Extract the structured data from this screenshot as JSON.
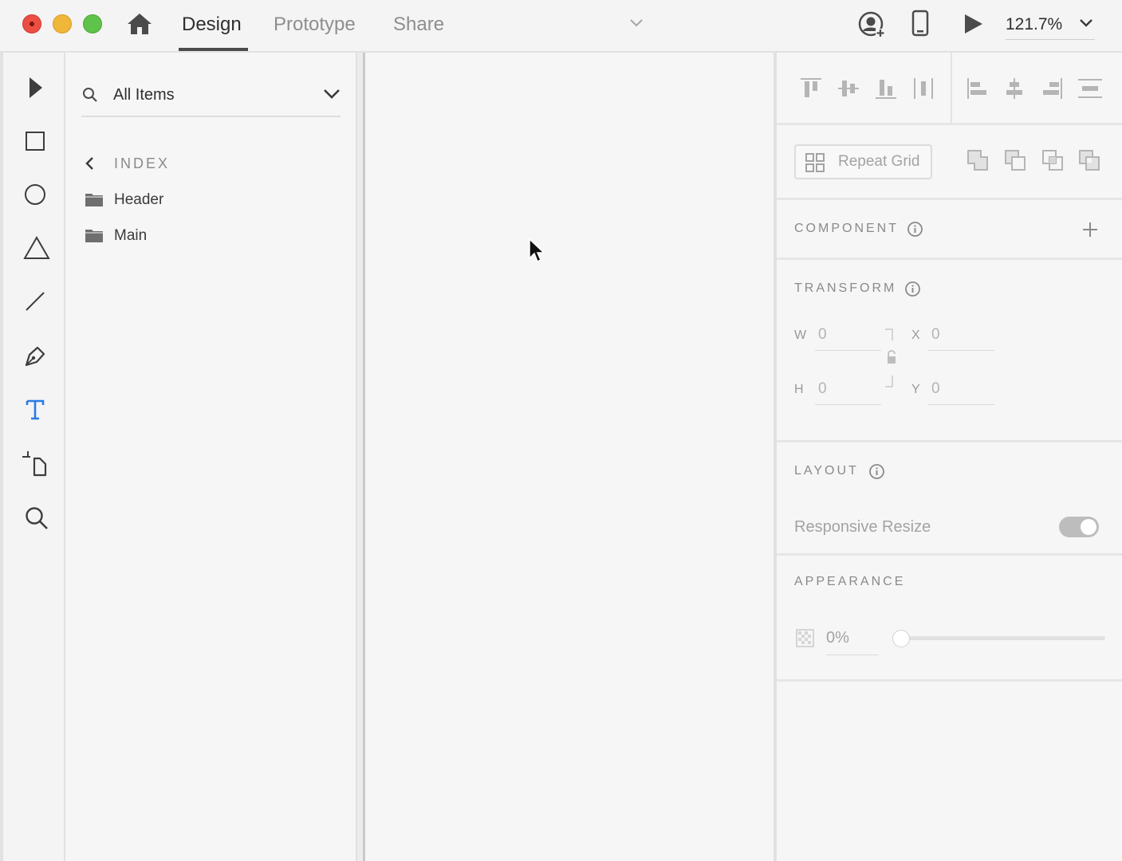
{
  "titlebar": {
    "tabs": [
      {
        "label": "Design",
        "active": true
      },
      {
        "label": "Prototype",
        "active": false
      },
      {
        "label": "Share",
        "active": false
      }
    ],
    "zoom": "121.7%",
    "icons": [
      "home-icon",
      "user-invite-icon",
      "mobile-preview-icon",
      "play-icon",
      "chevron-down-icon"
    ]
  },
  "tools": [
    "select-tool",
    "rectangle-tool",
    "ellipse-tool",
    "polygon-tool",
    "line-tool",
    "pen-tool",
    "text-tool",
    "artboard-tool",
    "zoom-tool"
  ],
  "layers": {
    "filter_label": "All Items",
    "breadcrumb": "INDEX",
    "items": [
      {
        "name": "Header",
        "icon": "folder-icon"
      },
      {
        "name": "Main",
        "icon": "folder-icon"
      }
    ]
  },
  "inspector": {
    "repeat_grid_label": "Repeat Grid",
    "component_title": "COMPONENT",
    "transform_title": "TRANSFORM",
    "transform": {
      "w_label": "W",
      "w_value": "0",
      "h_label": "H",
      "h_value": "0",
      "x_label": "X",
      "x_value": "0",
      "y_label": "Y",
      "y_value": "0"
    },
    "layout_title": "LAYOUT",
    "responsive_resize_label": "Responsive Resize",
    "responsive_resize_on": true,
    "appearance_title": "APPEARANCE",
    "opacity_value": "0%",
    "opacity_slider_fraction": 0
  },
  "colors": {
    "accent_text_tool": "#2c7be5",
    "close": "#ec4e43",
    "minimize": "#f0b63a",
    "maximize": "#5fc24a"
  }
}
